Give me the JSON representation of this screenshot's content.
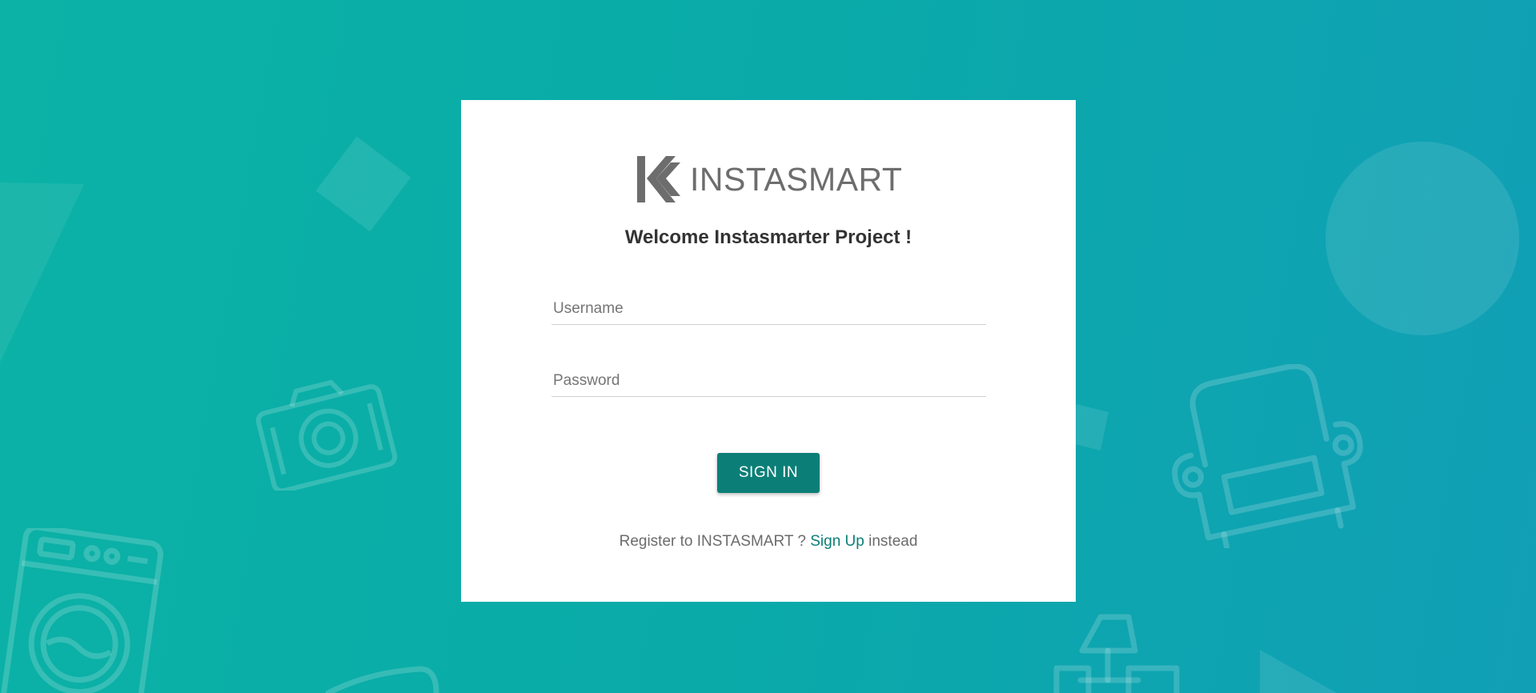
{
  "brand": {
    "name": "INSTASMART",
    "accent": "#0b7f77",
    "background_start": "#0bb2a5",
    "background_end": "#119fb6"
  },
  "login": {
    "welcome": "Welcome Instasmarter Project !",
    "username_placeholder": "Username",
    "password_placeholder": "Password",
    "signin_label": "SIGN IN",
    "register_prefix": "Register to INSTASMART ?",
    "register_link": "Sign Up",
    "register_suffix": "instead"
  },
  "background_icons": [
    "camera-icon",
    "armchair-icon",
    "washing-machine-icon",
    "lamp-icon",
    "diamond-shape",
    "circle-shape",
    "triangle-shape"
  ]
}
